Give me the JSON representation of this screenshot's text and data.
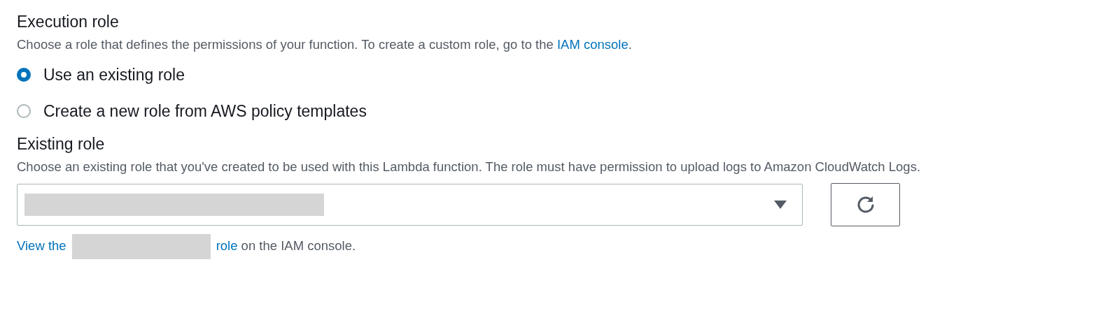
{
  "execution_role": {
    "title": "Execution role",
    "description_before": "Choose a role that defines the permissions of your function. To create a custom role, go to the ",
    "description_link": "IAM console",
    "description_after": ".",
    "options": [
      {
        "label": "Use an existing role",
        "selected": true
      },
      {
        "label": "Create a new role from AWS policy templates",
        "selected": false
      }
    ]
  },
  "existing_role": {
    "title": "Existing role",
    "description": "Choose an existing role that you've created to be used with this Lambda function. The role must have permission to upload logs to Amazon CloudWatch Logs.",
    "view_link_start": "View the",
    "view_link_end": "role",
    "view_after": " on the IAM console."
  }
}
